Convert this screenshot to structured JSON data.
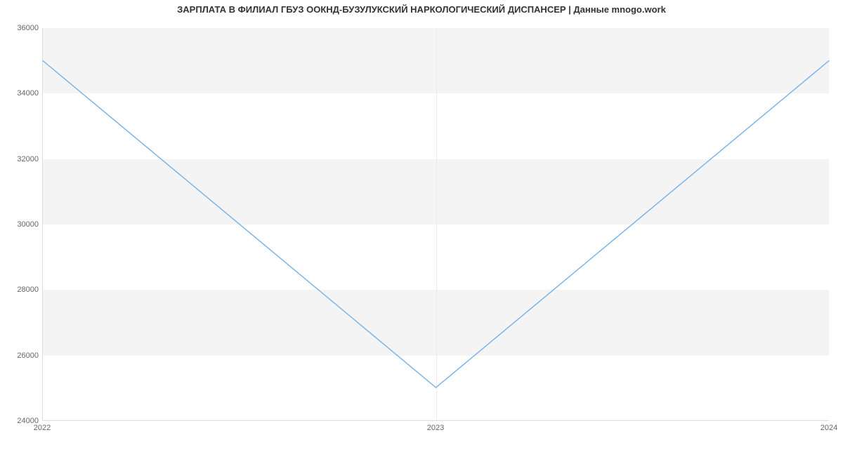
{
  "chart_data": {
    "type": "line",
    "title": "ЗАРПЛАТА В ФИЛИАЛ ГБУЗ ООКНД-БУЗУЛУКСКИЙ НАРКОЛОГИЧЕСКИЙ ДИСПАНСЕР | Данные mnogo.work",
    "x": [
      "2022",
      "2023",
      "2024"
    ],
    "values": [
      35000,
      25000,
      35000
    ],
    "xlabel": "",
    "ylabel": "",
    "ylim": [
      24000,
      36000
    ],
    "y_ticks": [
      24000,
      26000,
      28000,
      30000,
      32000,
      34000,
      36000
    ],
    "x_ticks": [
      "2022",
      "2023",
      "2024"
    ],
    "line_color": "#7cb5ec"
  }
}
